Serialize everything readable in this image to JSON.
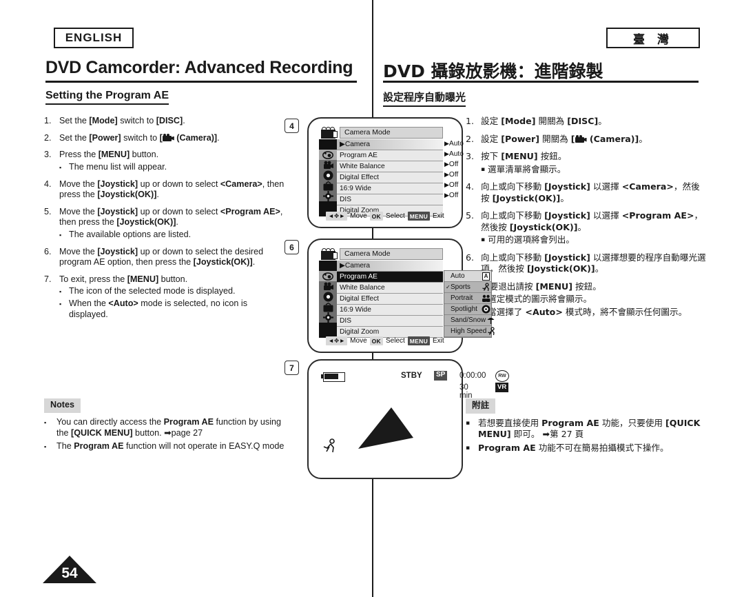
{
  "language_badges": {
    "english": "ENGLISH",
    "chinese": "臺 灣"
  },
  "titles": {
    "english": "DVD Camcorder: Advanced Recording",
    "chinese": "DVD 攝錄放影機：進階錄製"
  },
  "section_headings": {
    "english": "Setting the Program AE",
    "chinese": "設定程序自動曝光"
  },
  "steps_en": [
    {
      "num": "1.",
      "text": "Set the [Mode] switch to [DISC].",
      "subs": []
    },
    {
      "num": "2.",
      "text": "Set the [Power] switch to  [ (Camera)].",
      "subs": []
    },
    {
      "num": "3.",
      "text": "Press the [MENU] button.",
      "subs": [
        "The menu list will appear."
      ]
    },
    {
      "num": "4.",
      "text": "Move the [Joystick] up or down to select <Camera>, then press the [Joystick(OK)].",
      "subs": []
    },
    {
      "num": "5.",
      "text": "Move the [Joystick] up or down to select <Program AE>, then press the [Joystick(OK)].",
      "subs": [
        "The available options are listed."
      ]
    },
    {
      "num": "6.",
      "text": "Move the [Joystick] up or down to select the desired program AE option, then press the [Joystick(OK)].",
      "subs": []
    },
    {
      "num": "7.",
      "text": "To exit, press the [MENU] button.",
      "subs": [
        "The icon of the selected mode is displayed.",
        "When the <Auto> mode is selected, no icon is displayed."
      ]
    }
  ],
  "steps_zh": [
    {
      "num": "1.",
      "text": "設定 [Mode] 開關為 [DISC]。",
      "subs": []
    },
    {
      "num": "2.",
      "text": "設定 [Power] 開關為 [ (Camera)]。",
      "subs": []
    },
    {
      "num": "3.",
      "text": "按下 [MENU] 按鈕。",
      "subs": [
        "選單清單將會顯示。"
      ]
    },
    {
      "num": "4.",
      "text": "向上或向下移動 [Joystick] 以選擇 <Camera>，然後按 [Joystick(OK)]。",
      "subs": []
    },
    {
      "num": "5.",
      "text": "向上或向下移動 [Joystick] 以選擇 <Program AE>，然後按 [Joystick(OK)]。",
      "subs": [
        "可用的選項將會列出。"
      ]
    },
    {
      "num": "6.",
      "text": "向上或向下移動 [Joystick] 以選擇想要的程序自動曝光選項，然後按 [Joystick(OK)]。",
      "subs": []
    },
    {
      "num": "7.",
      "text": "若要退出請按 [MENU] 按鈕。",
      "subs": [
        "選定模式的圖示將會顯示。",
        "當選擇了 <Auto> 模式時，將不會顯示任何圖示。"
      ]
    }
  ],
  "notes_en": {
    "label": "Notes",
    "items": [
      "You can directly access the Program AE function by using the [QUICK MENU] button. ➡page 27",
      "The Program AE function will not operate in EASY.Q mode"
    ]
  },
  "notes_zh": {
    "label": "附註",
    "items": [
      "若想要直接使用 Program AE 功能，只要使用 [QUICK MENU] 即可。 ➡第 27 頁",
      "Program AE 功能不可在簡易拍攝模式下操作。"
    ]
  },
  "markers": {
    "four": "4",
    "six": "6",
    "seven": "7"
  },
  "lcd_menu": {
    "title": "Camera Mode",
    "breadcrumb": "Camera",
    "rows": [
      {
        "label": "Program AE",
        "value": "Auto"
      },
      {
        "label": "White Balance",
        "value": "Auto"
      },
      {
        "label": "Digital Effect",
        "value": "Off"
      },
      {
        "label": "16:9 Wide",
        "value": "Off"
      },
      {
        "label": "DIS",
        "value": "Off"
      },
      {
        "label": "Digital Zoom",
        "value": "Off"
      }
    ],
    "footer": {
      "move": "Move",
      "select": "Select",
      "exit": "Exit",
      "ok_key": "OK",
      "menu_key": "MENU"
    },
    "icons": [
      "photo-mode-icon",
      "camcorder-icon",
      "record-disc-icon",
      "tv-icon",
      "settings-gear-icon"
    ]
  },
  "lcd_options": {
    "selected_row": "Program AE",
    "checked": "Sports",
    "options": [
      {
        "label": "Auto",
        "icon": "A",
        "checked": false
      },
      {
        "label": "Sports",
        "icon": "🏃",
        "checked": true
      },
      {
        "label": "Portrait",
        "icon": "👥",
        "checked": false
      },
      {
        "label": "Spotlight",
        "icon": "◉",
        "checked": false
      },
      {
        "label": "Sand/Snow",
        "icon": "⛱",
        "checked": false
      },
      {
        "label": "High Speed",
        "icon": "🏃",
        "checked": false
      }
    ]
  },
  "lcd_stby": {
    "status": "STBY",
    "quality": "SP",
    "timecode": "0:00:00",
    "disc_mode": "RW",
    "remaining": "30 min",
    "format": "VR",
    "mode_icon": "sports-mode-icon"
  },
  "page_number": "54"
}
